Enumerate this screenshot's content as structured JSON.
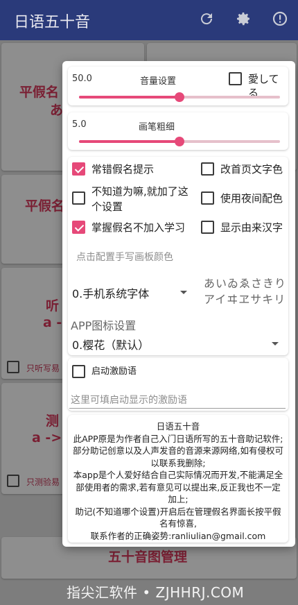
{
  "appbar": {
    "title": "日语五十音",
    "refresh_icon": "refresh-icon",
    "settings_icon": "gear-icon",
    "info_icon": "alert-circle-icon"
  },
  "background": {
    "card1_line1": "平假名",
    "card1_line2": "あ",
    "card2_line1": "平假名",
    "card3_line1": "听",
    "card3_line2": "a -",
    "card3_check": "只听写易",
    "card4_line1": "测",
    "card4_line2": "a ->",
    "card4_check": "只测验易",
    "bottom_title": "五十音图管理"
  },
  "settings": {
    "volume": {
      "label": "音量设置",
      "value_text": "50.0",
      "value": 50,
      "max": 100
    },
    "love_checkbox": {
      "label": "愛してる",
      "checked": false
    },
    "brush": {
      "label": "画笔粗细",
      "value_text": "5.0",
      "value": 5,
      "max": 10
    },
    "options": [
      {
        "label": "常错假名提示",
        "checked": true
      },
      {
        "label": "改首页文字色",
        "checked": false
      },
      {
        "label_line1": "不知道为嘛,就加了这",
        "label_line2": "个设置",
        "checked": false
      },
      {
        "label": "使用夜间配色",
        "checked": false
      },
      {
        "label": "掌握假名不加入学习",
        "checked": true
      },
      {
        "label": "显示由来汉字",
        "checked": false
      }
    ],
    "pad_color_hint": "点击配置手写画板颜色",
    "font_select": {
      "selected": "0.手机系统字体"
    },
    "font_preview": {
      "hiragana": "あいゐゑさきり",
      "katakana": "アイヰヱサキリ"
    },
    "icon_setting": {
      "label": "APP图标设置",
      "selected": "0.樱花（默认）"
    },
    "motto": {
      "label": "启动激励语",
      "checked": false,
      "placeholder": "这里可填启动显示的激励语"
    }
  },
  "about": {
    "title": "日语五十音",
    "lines": [
      "此APP原是为作者自己入门日语所写的五十音助记软件;",
      "部分助记创意以及人声发音的音源来源网络,如有侵权可",
      "以联系我删除;",
      "本app是个人爱好结合自己实际情况而开发,不能满足全",
      "部使用者的需求,若有意见可以提出来,反正我也不一定",
      "加上;",
      "助记(不知道哪个设置)开启后在管理假名界面长按平假",
      "名有惊喜,",
      "联系作者的正确姿势:ranliulian@gmail.com"
    ]
  },
  "watermark": "指尖汇软件 • ZJHHRJ.COM",
  "colors": {
    "accent": "#e64979",
    "appbar": "#2a3a7a"
  }
}
